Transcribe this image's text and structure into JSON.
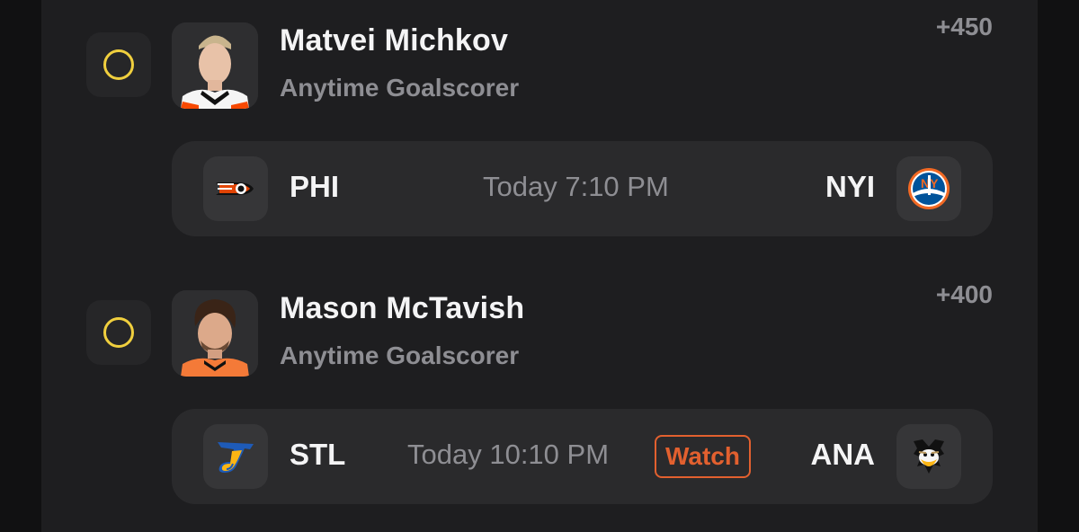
{
  "picks": [
    {
      "player_name": "Matvei Michkov",
      "market": "Anytime Goalscorer",
      "odds": "+450",
      "jersey_color": "#f74902",
      "game": {
        "home_abbr": "PHI",
        "home_logo": "flyers-logo-icon",
        "time": "Today 7:10 PM",
        "away_abbr": "NYI",
        "away_logo": "islanders-logo-icon"
      }
    },
    {
      "player_name": "Mason McTavish",
      "market": "Anytime Goalscorer",
      "odds": "+400",
      "jersey_color": "#f47a38",
      "game": {
        "home_abbr": "STL",
        "home_logo": "blues-logo-icon",
        "time": "Today 10:10 PM",
        "watch_label": "Watch",
        "away_abbr": "ANA",
        "away_logo": "ducks-logo-icon"
      }
    }
  ],
  "colors": {
    "radio": "#f0cf3e",
    "watch": "#e2602f",
    "text_primary": "#f4f4f5",
    "text_secondary": "#8e8e93"
  }
}
